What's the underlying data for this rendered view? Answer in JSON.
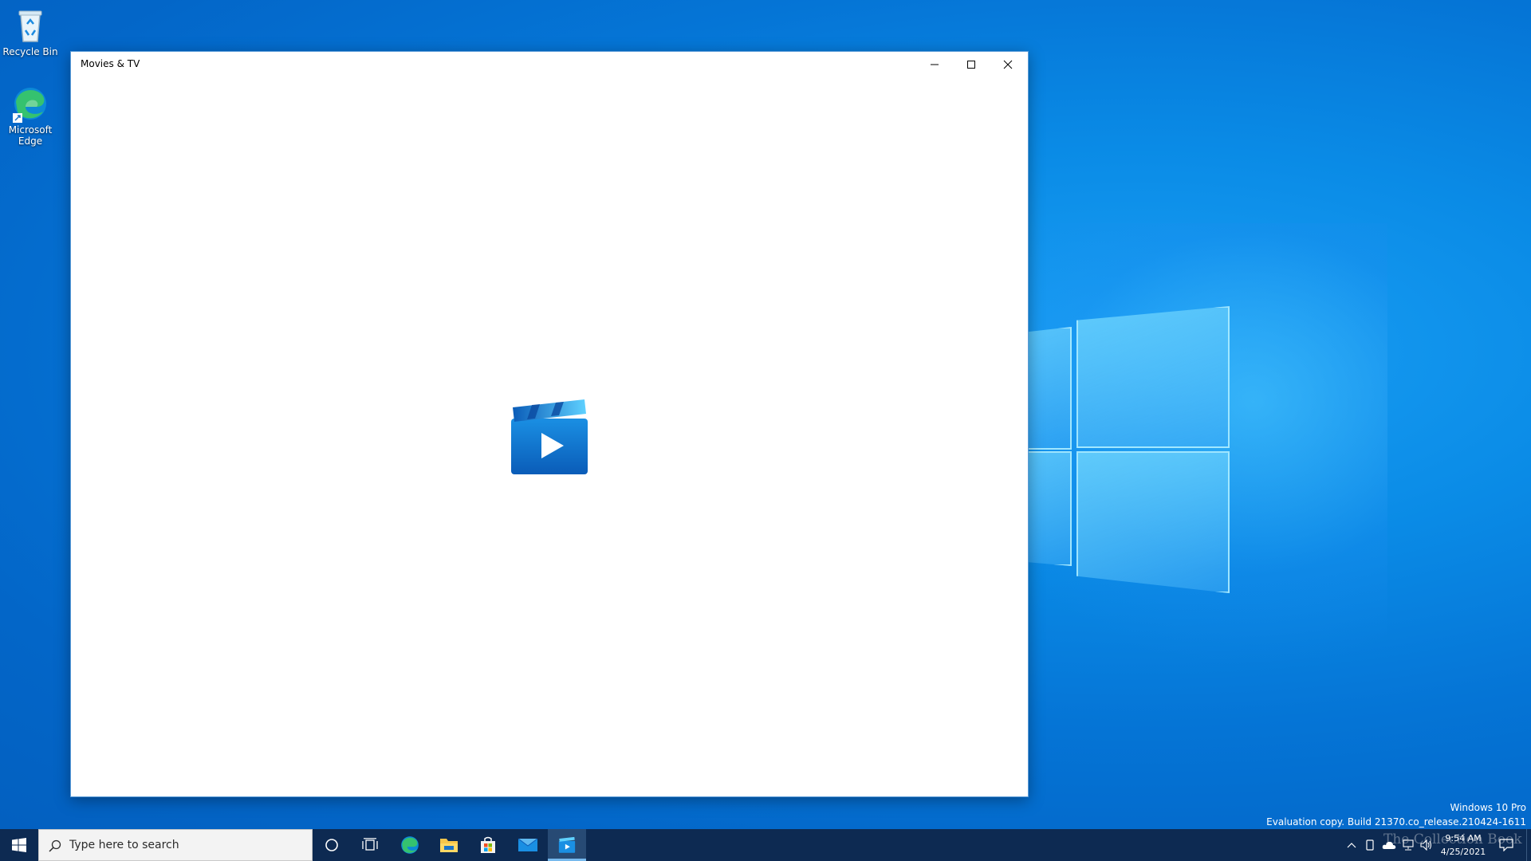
{
  "desktop": {
    "icons": [
      {
        "label": "Recycle Bin",
        "icon": "recycle-bin-icon"
      },
      {
        "label": "Microsoft Edge",
        "icon": "edge-icon"
      }
    ]
  },
  "window": {
    "title": "Movies & TV",
    "minimize_icon": "minimize-icon",
    "maximize_icon": "maximize-icon",
    "close_icon": "close-icon",
    "splash_icon": "movies-tv-logo-icon"
  },
  "watermark": {
    "edition": "Windows 10 Pro",
    "build": "Evaluation copy. Build 21370.co_release.210424-1611"
  },
  "taskbar": {
    "search_placeholder": "Type here to search",
    "pinned": [
      "start-icon",
      "cortana-icon",
      "task-view-icon",
      "edge-icon",
      "file-explorer-icon",
      "store-icon",
      "mail-icon",
      "movies-tv-icon"
    ],
    "active_app": "Movies & TV",
    "time": "9:54 AM",
    "date": "4/25/2021",
    "bottom_watermark": "The Collection Book",
    "accent_color": "#76b9ed"
  }
}
